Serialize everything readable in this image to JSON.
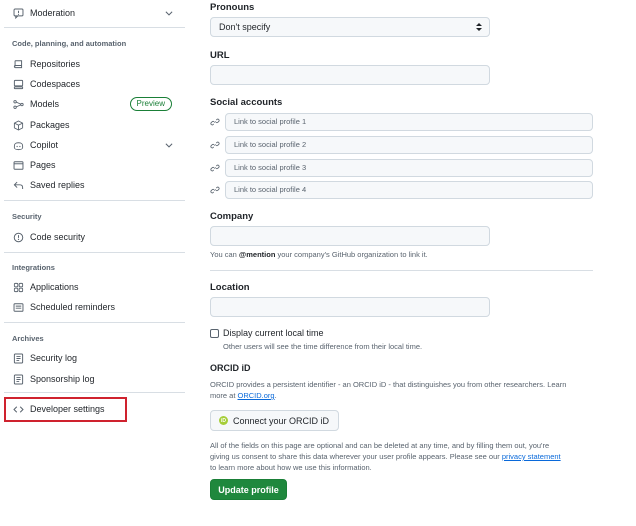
{
  "sidebar": {
    "items": [
      {
        "label": "Moderation",
        "icon": "report-icon"
      },
      {
        "label": "Repositories",
        "icon": "repo-icon"
      },
      {
        "label": "Codespaces",
        "icon": "codespaces-icon"
      },
      {
        "label": "Models",
        "icon": "models-icon",
        "badge": "Preview"
      },
      {
        "label": "Packages",
        "icon": "package-icon"
      },
      {
        "label": "Copilot",
        "icon": "copilot-icon"
      },
      {
        "label": "Pages",
        "icon": "browser-icon"
      },
      {
        "label": "Saved replies",
        "icon": "reply-icon"
      },
      {
        "label": "Code security",
        "icon": "shield-icon"
      },
      {
        "label": "Applications",
        "icon": "apps-icon"
      },
      {
        "label": "Scheduled reminders",
        "icon": "clock-icon"
      },
      {
        "label": "Security log",
        "icon": "log-icon"
      },
      {
        "label": "Sponsorship log",
        "icon": "log-icon"
      },
      {
        "label": "Developer settings",
        "icon": "code-icon"
      }
    ],
    "sections": {
      "code": "Code, planning, and automation",
      "security": "Security",
      "integrations": "Integrations",
      "archives": "Archives"
    }
  },
  "form": {
    "pronouns_label": "Pronouns",
    "pronouns_value": "Don't specify",
    "url_label": "URL",
    "social_label": "Social accounts",
    "social_placeholders": [
      "Link to social profile 1",
      "Link to social profile 2",
      "Link to social profile 3",
      "Link to social profile 4"
    ],
    "company_label": "Company",
    "company_note_pre": "You can ",
    "company_note_mention": "@mention",
    "company_note_post": " your company's GitHub organization to link it.",
    "location_label": "Location",
    "local_time_label": "Display current local time",
    "local_time_note": "Other users will see the time difference from their local time.",
    "orcid_label": "ORCID iD",
    "orcid_note_line1": "ORCID provides a persistent identifier - an ORCID iD - that distinguishes you from other researchers. Learn",
    "orcid_note_line2_pre": "more at ",
    "orcid_note_link": "ORCID.org",
    "orcid_note_line2_post": ".",
    "orcid_button": "Connect your ORCID iD",
    "optional_note_line1": "All of the fields on this page are optional and can be deleted at any time, and by filling them out, you're",
    "optional_note_line2_pre": "giving us consent to share this data wherever your user profile appears. Please see our ",
    "optional_note_link": "privacy statement",
    "optional_note_line3": "to learn more about how we use this information.",
    "update_button": "Update profile"
  },
  "colors": {
    "accent_green": "#1f883d",
    "link_blue": "#0969da",
    "highlight_red": "#cf222e"
  }
}
